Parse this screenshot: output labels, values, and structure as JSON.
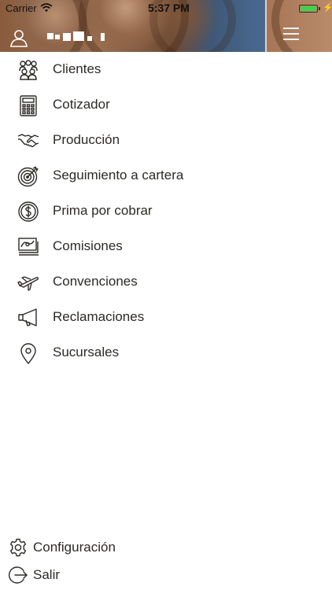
{
  "status_bar": {
    "carrier": "Carrier",
    "time": "5:37 PM",
    "battery_color": "#3dd34a"
  },
  "header": {
    "profile_icon": "user-profile-icon",
    "menu_icon": "hamburger-menu-icon"
  },
  "menu": {
    "items": [
      {
        "label": "Clientes",
        "icon": "people-group-icon"
      },
      {
        "label": "Cotizador",
        "icon": "calculator-icon"
      },
      {
        "label": "Producción",
        "icon": "handshake-icon"
      },
      {
        "label": "Seguimiento a cartera",
        "icon": "target-icon"
      },
      {
        "label": "Prima por cobrar",
        "icon": "dollar-coin-icon"
      },
      {
        "label": "Comisiones",
        "icon": "money-stack-icon"
      },
      {
        "label": "Convenciones",
        "icon": "airplane-icon"
      },
      {
        "label": "Reclamaciones",
        "icon": "megaphone-icon"
      },
      {
        "label": "Sucursales",
        "icon": "location-pin-icon"
      }
    ]
  },
  "footer": {
    "settings_label": "Configuración",
    "settings_icon": "gear-icon",
    "logout_label": "Salir",
    "logout_icon": "logout-icon"
  },
  "colors": {
    "text": "#2c2a25",
    "background": "#ffffff",
    "header_blue": "#4a6a91",
    "header_brown": "#9a6e4f"
  }
}
